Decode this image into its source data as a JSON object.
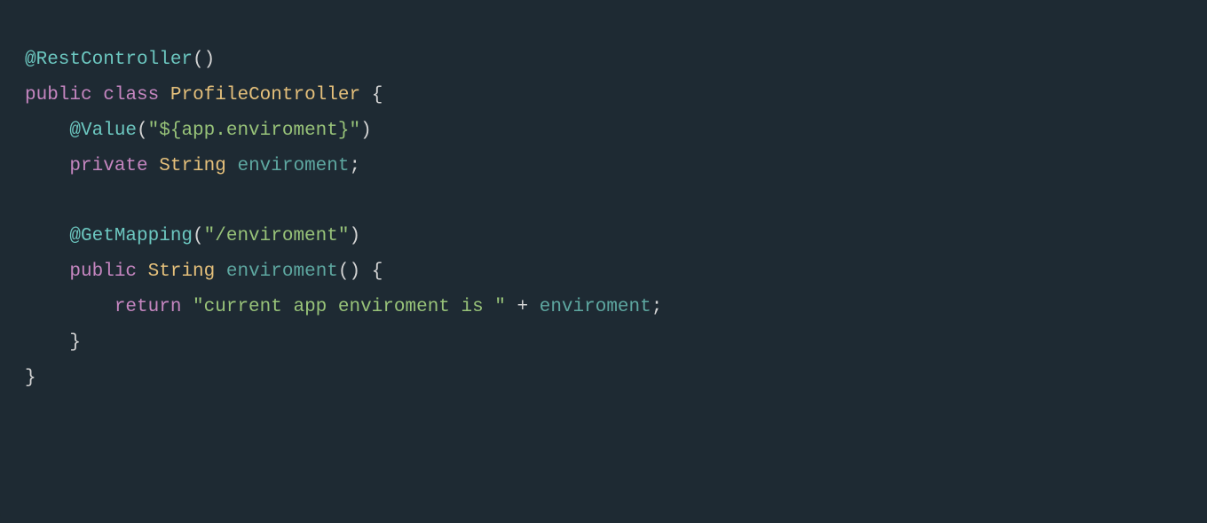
{
  "code": {
    "line1": {
      "annotation": "@RestController",
      "parens": "()"
    },
    "line2": {
      "kw_public": "public",
      "kw_class": "class",
      "class_name": "ProfileController",
      "brace": " {"
    },
    "line3": {
      "annotation": "@Value",
      "paren_open": "(",
      "string": "\"${app.enviroment}\"",
      "paren_close": ")"
    },
    "line4": {
      "kw_private": "private",
      "type": "String",
      "var_name": "enviroment",
      "semi": ";"
    },
    "line5": {
      "annotation": "@GetMapping",
      "paren_open": "(",
      "string": "\"/enviroment\"",
      "paren_close": ")"
    },
    "line6": {
      "kw_public": "public",
      "type": "String",
      "method_name": "enviroment",
      "parens": "()",
      "brace": " {"
    },
    "line7": {
      "kw_return": "return",
      "string": "\"current app enviroment is \"",
      "op_plus": " + ",
      "var_ref": "enviroment",
      "semi": ";"
    },
    "line8": {
      "brace": "}"
    },
    "line9": {
      "brace": "}"
    }
  }
}
